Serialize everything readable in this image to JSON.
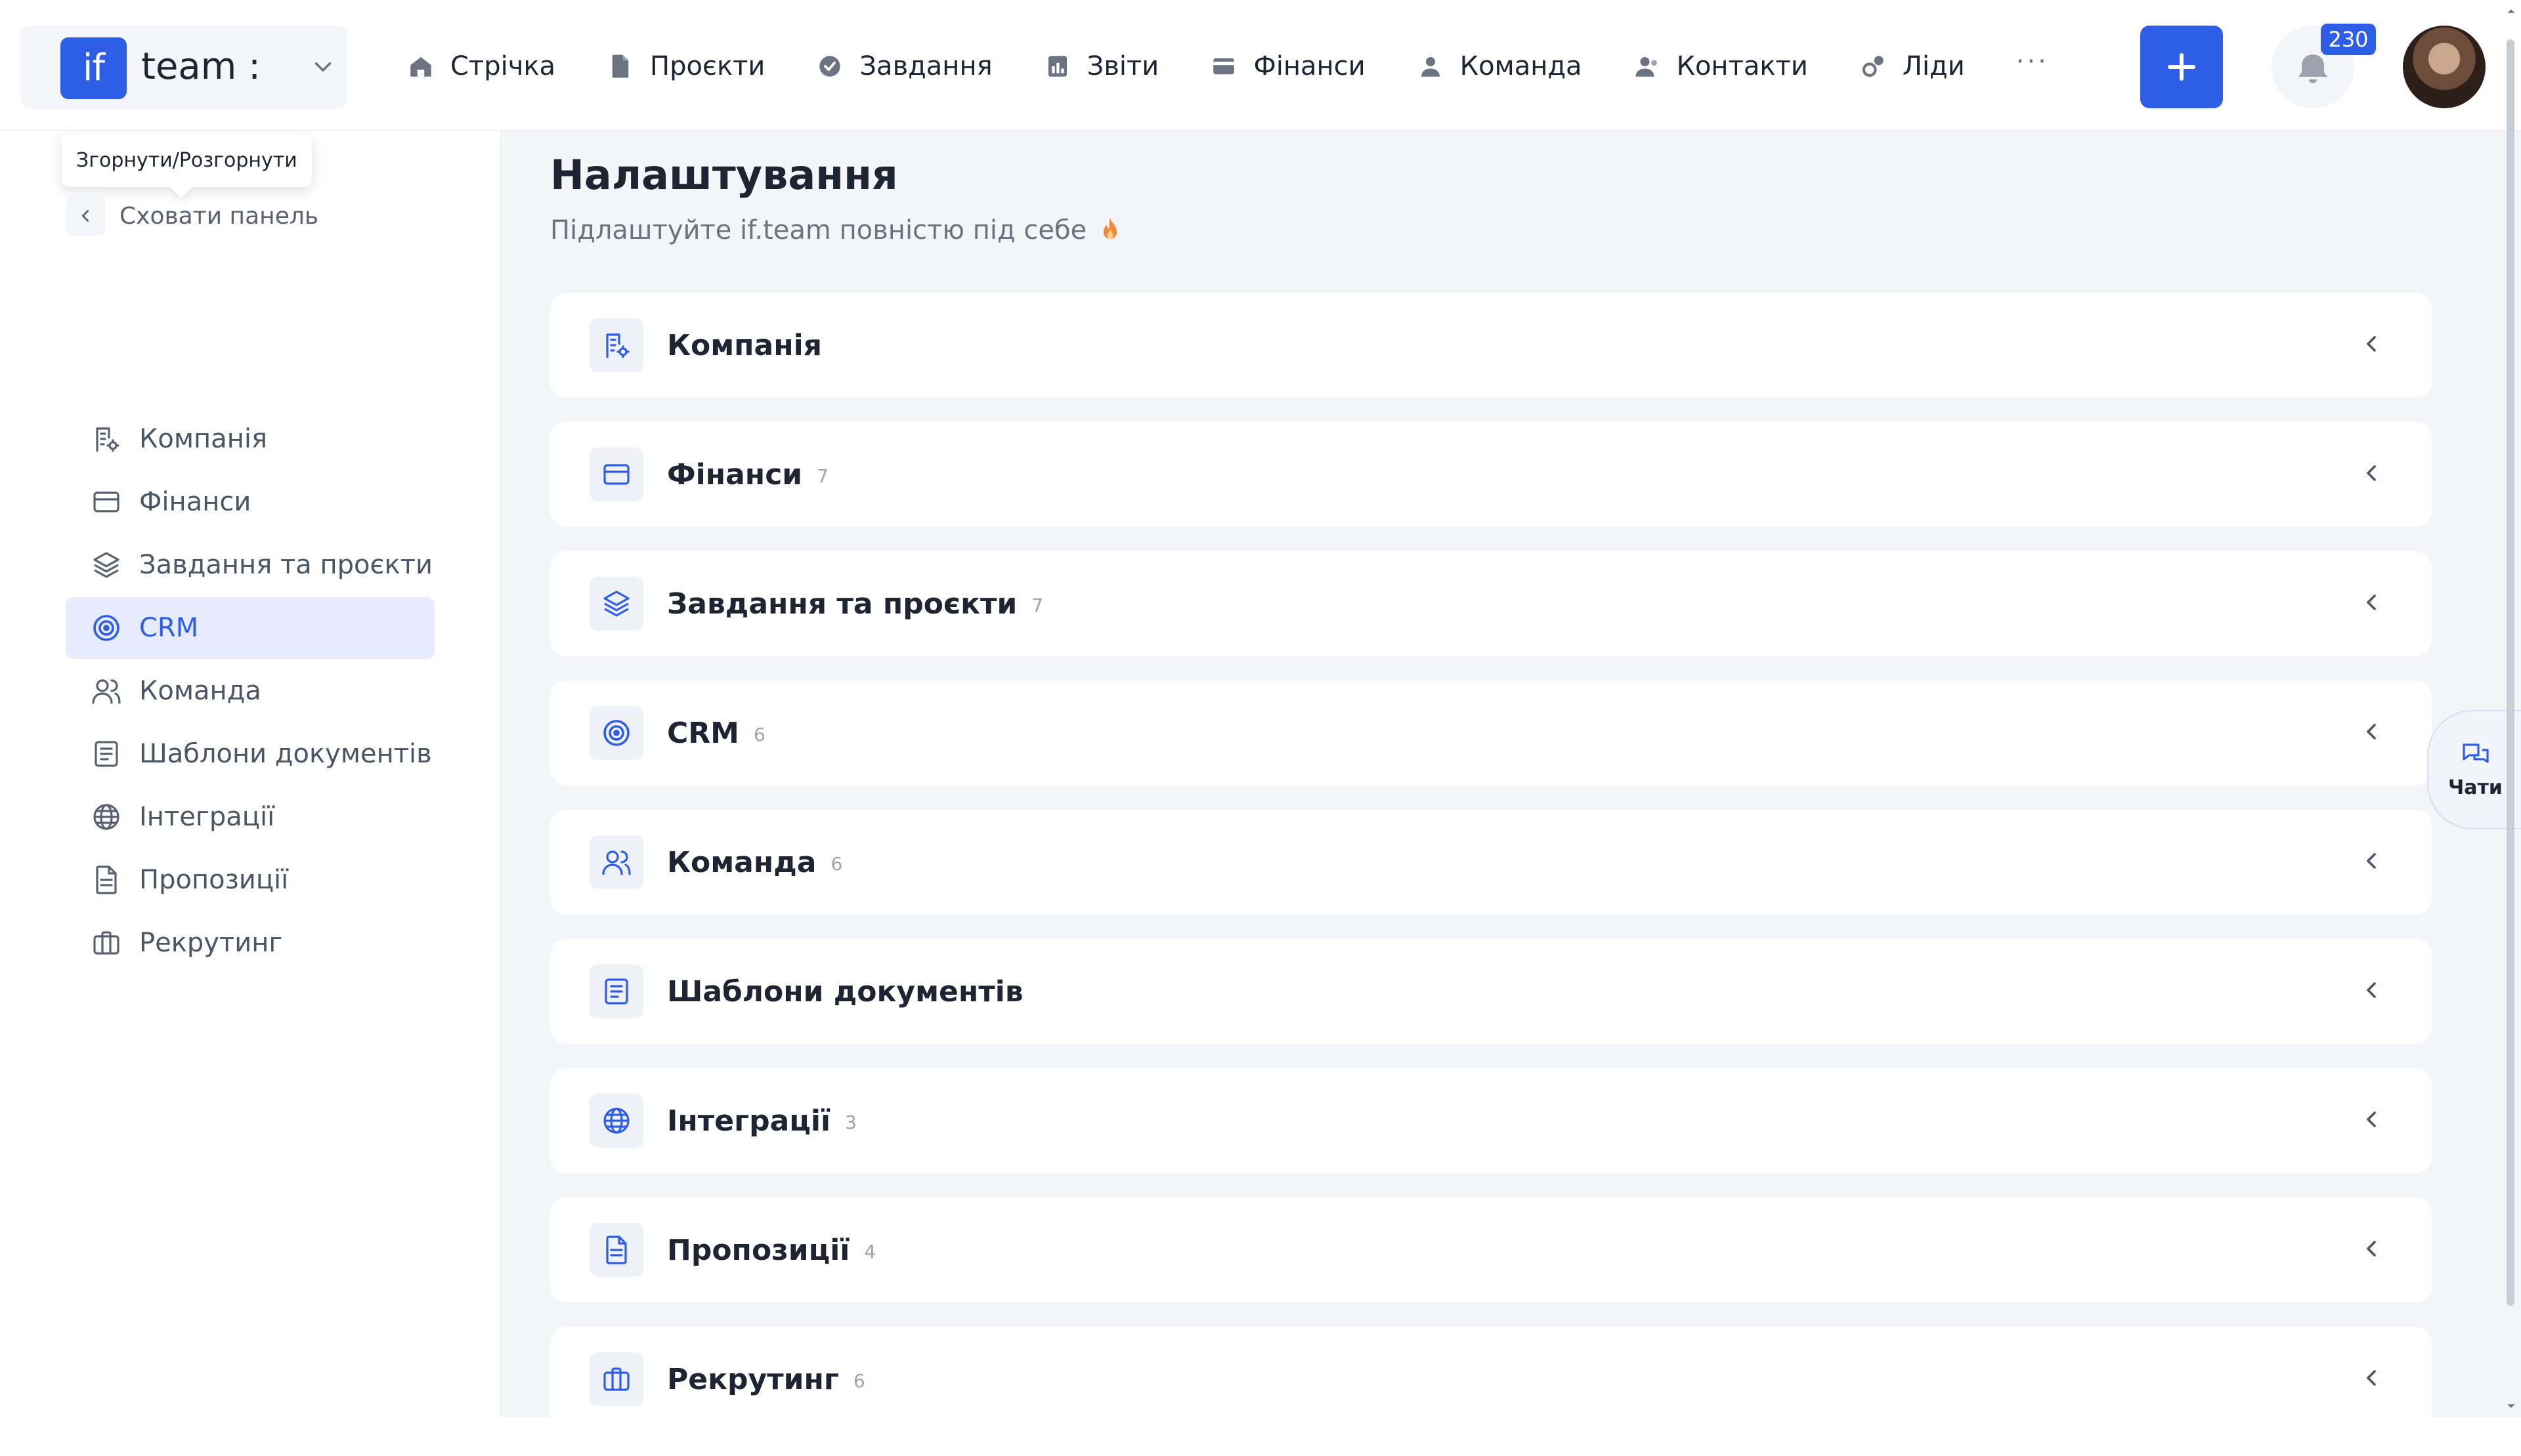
{
  "colors": {
    "accent": "#2f5ee6",
    "accent_soft": "#e6ecfd",
    "background": "#f4f5f8"
  },
  "brand": {
    "logo_text": "if",
    "name": "team :"
  },
  "nav": [
    {
      "label": "Стрічка",
      "icon": "home-icon"
    },
    {
      "label": "Проєкти",
      "icon": "document-icon"
    },
    {
      "label": "Завдання",
      "icon": "check-circle-icon"
    },
    {
      "label": "Звіти",
      "icon": "report-icon"
    },
    {
      "label": "Фінанси",
      "icon": "wallet-icon"
    },
    {
      "label": "Команда",
      "icon": "user-icon"
    },
    {
      "label": "Контакти",
      "icon": "contacts-icon"
    },
    {
      "label": "Ліди",
      "icon": "leads-icon"
    }
  ],
  "nav_more": "···",
  "notifications": {
    "count": "230"
  },
  "sidebar": {
    "tooltip": "Згорнути/Розгорнути",
    "hide_label": "Сховати панель",
    "items": [
      {
        "label": "Компанія",
        "icon": "company-settings-icon"
      },
      {
        "label": "Фінанси",
        "icon": "credit-card-icon"
      },
      {
        "label": "Завдання та проєкти",
        "icon": "layers-icon"
      },
      {
        "label": "CRM",
        "icon": "target-icon"
      },
      {
        "label": "Команда",
        "icon": "users-icon"
      },
      {
        "label": "Шаблони документів",
        "icon": "document-template-icon"
      },
      {
        "label": "Інтеграції",
        "icon": "globe-icon"
      },
      {
        "label": "Пропозиції",
        "icon": "file-text-icon"
      },
      {
        "label": "Рекрутинг",
        "icon": "briefcase-icon"
      }
    ],
    "active_index": 3
  },
  "main": {
    "title": "Налаштування",
    "subtitle": "Підлаштуйте if.team повністю під себе",
    "sections": [
      {
        "title": "Компанія",
        "count": ""
      },
      {
        "title": "Фінанси",
        "count": "7"
      },
      {
        "title": "Завдання та проєкти",
        "count": "7"
      },
      {
        "title": "CRM",
        "count": "6"
      },
      {
        "title": "Команда",
        "count": "6"
      },
      {
        "title": "Шаблони документів",
        "count": ""
      },
      {
        "title": "Інтеграції",
        "count": "3"
      },
      {
        "title": "Пропозиції",
        "count": "4"
      },
      {
        "title": "Рекрутинг",
        "count": "6"
      }
    ]
  },
  "chats": {
    "label": "Чати"
  }
}
